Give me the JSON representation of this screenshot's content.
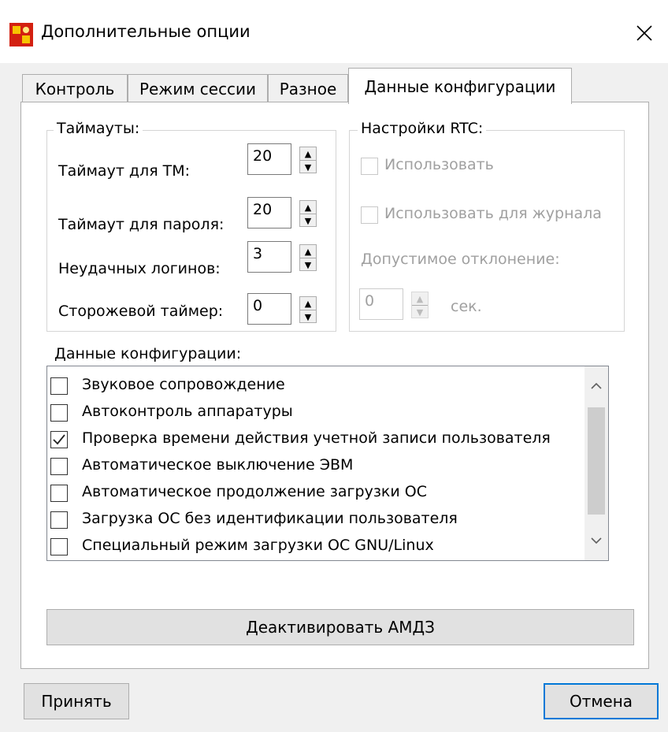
{
  "window": {
    "title": "Дополнительные опции"
  },
  "tabs": [
    "Контроль",
    "Режим сессии",
    "Разное",
    "Данные конфигурации"
  ],
  "active_tab_index": 3,
  "timeouts": {
    "title": "Таймауты:",
    "rows": [
      {
        "label": "Таймаут для ТМ:",
        "value": "20"
      },
      {
        "label": "Таймаут для пароля:",
        "value": "20"
      },
      {
        "label": "Неудачных логинов:",
        "value": "3"
      },
      {
        "label": "Сторожевой таймер:",
        "value": "0"
      }
    ]
  },
  "rtc": {
    "title": "Настройки RTC:",
    "use_label": "Использовать",
    "use_journal_label": "Использовать для журнала",
    "deviation_label": "Допустимое отклонение:",
    "deviation_value": "0",
    "unit": "сек.",
    "enabled": false
  },
  "config": {
    "title": "Данные конфигурации:",
    "items": [
      {
        "label": "Звуковое сопровождение",
        "checked": false
      },
      {
        "label": "Автоконтроль аппаратуры",
        "checked": false
      },
      {
        "label": "Проверка времени действия учетной записи пользователя",
        "checked": true
      },
      {
        "label": "Автоматическое выключение ЭВМ",
        "checked": false
      },
      {
        "label": "Автоматическое продолжение загрузки ОС",
        "checked": false
      },
      {
        "label": "Загрузка ОС без идентификации пользователя",
        "checked": false
      },
      {
        "label": "Специальный режим загрузки ОС GNU/Linux",
        "checked": false
      }
    ]
  },
  "buttons": {
    "deactivate": "Деактивировать АМДЗ",
    "accept": "Принять",
    "cancel": "Отмена"
  },
  "colors": {
    "accent": "#0078d7",
    "disabled_text": "#a0a0a0"
  }
}
